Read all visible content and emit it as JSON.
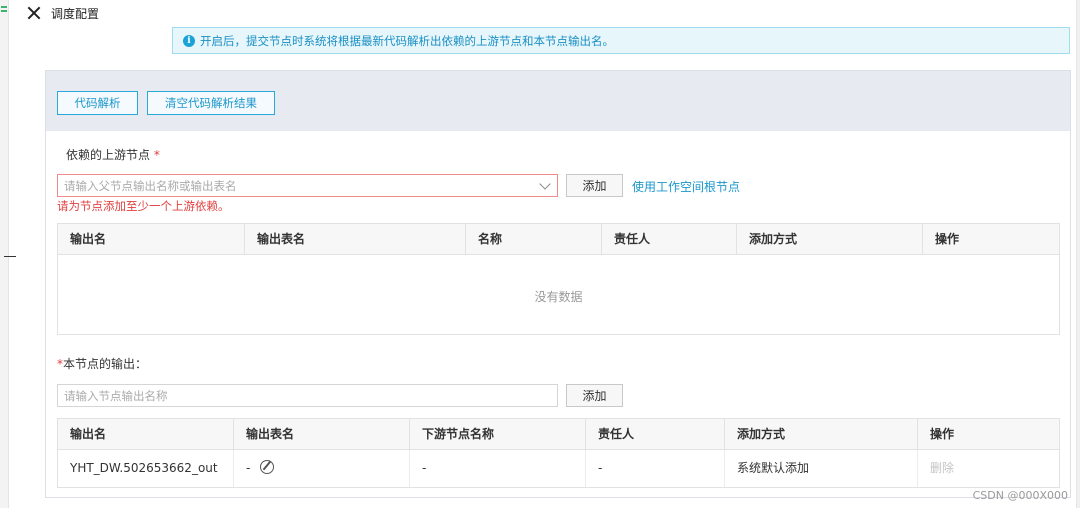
{
  "window": {
    "title": "调度配置"
  },
  "info": {
    "text": "开启后，提交节点时系统将根据最新代码解析出依赖的上游节点和本节点输出名。"
  },
  "toolbar": {
    "parse_label": "代码解析",
    "clear_label": "清空代码解析结果"
  },
  "upstream": {
    "label": "依赖的上游节点",
    "required_mark": "*",
    "select_placeholder": "请输入父节点输出名称或输出表名",
    "add_label": "添加",
    "use_root_label": "使用工作空间根节点",
    "error": "请为节点添加至少一个上游依赖。",
    "columns": [
      "输出名",
      "输出表名",
      "名称",
      "责任人",
      "添加方式",
      "操作"
    ],
    "empty_text": "没有数据"
  },
  "output": {
    "required_mark": "*",
    "label": "本节点的输出：",
    "input_placeholder": "请输入节点输出名称",
    "add_label": "添加",
    "columns": [
      "输出名",
      "输出表名",
      "下游节点名称",
      "责任人",
      "添加方式",
      "操作"
    ],
    "rows": [
      {
        "output_name": "YHT_DW.502653662_out",
        "table_name": "-",
        "downstream": "-",
        "owner": "-",
        "add_method": "系统默认添加",
        "action": "删除"
      }
    ]
  },
  "watermark": "CSDN @000X000",
  "colors": {
    "accent": "#1b97cc",
    "error": "#e04040",
    "header_bg": "#e8eaf2"
  }
}
